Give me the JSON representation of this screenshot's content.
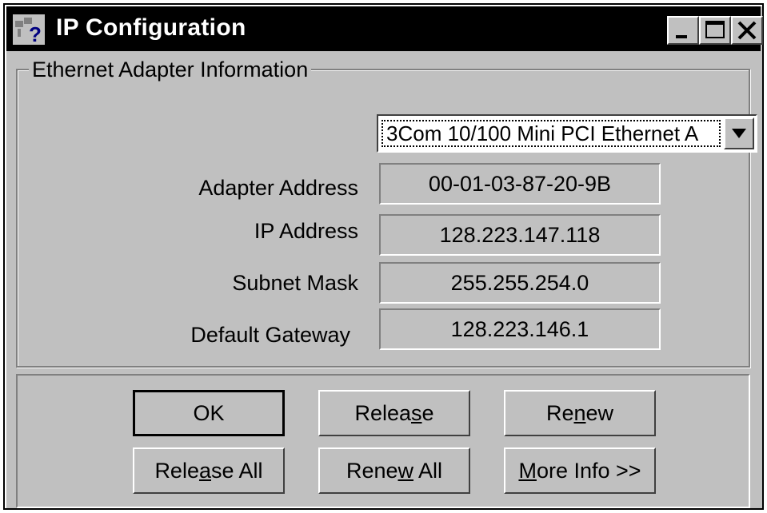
{
  "window": {
    "title": "IP Configuration",
    "minimize_label": "_",
    "maximize_label": "□",
    "close_label": "×"
  },
  "group": {
    "label": "Ethernet  Adapter Information"
  },
  "adapter_select": {
    "selected": "3Com 10/100 Mini PCI Ethernet A"
  },
  "fields": {
    "adapter_address_label": "Adapter Address",
    "adapter_address_value": "00-01-03-87-20-9B",
    "ip_address_label": "IP Address",
    "ip_address_value": "128.223.147.118",
    "subnet_mask_label": "Subnet Mask",
    "subnet_mask_value": "255.255.254.0",
    "default_gateway_label": "Default Gateway",
    "default_gateway_value": "128.223.146.1"
  },
  "buttons": {
    "ok": "OK",
    "release_pre": "Relea",
    "release_u": "s",
    "release_post": "e",
    "renew_pre": "Re",
    "renew_u": "n",
    "renew_post": "ew",
    "release_all_pre": "Rele",
    "release_all_u": "a",
    "release_all_post": "se All",
    "renew_all_pre": "Rene",
    "renew_all_u": "w",
    "renew_all_post": " All",
    "more_info_pre": "",
    "more_info_u": "M",
    "more_info_post": "ore Info >>"
  }
}
